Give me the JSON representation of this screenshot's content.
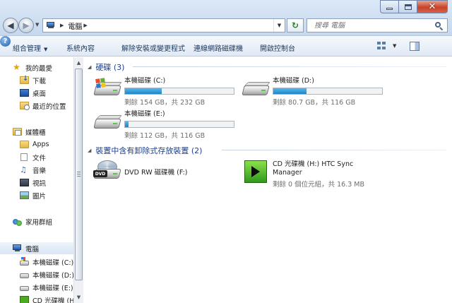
{
  "address": {
    "location": "電腦"
  },
  "search": {
    "placeholder": "搜尋 電腦"
  },
  "toolbar": {
    "organize": "組合管理",
    "system_properties": "系統內容",
    "uninstall": "解除安裝或變更程式",
    "map_network": "連線網路磁碟機",
    "control_panel": "開啟控制台"
  },
  "sidebar": {
    "favorites": "我的最愛",
    "downloads": "下載",
    "desktop": "桌面",
    "recent": "最近的位置",
    "libraries": "媒體櫃",
    "apps": "Apps",
    "documents": "文件",
    "music": "音樂",
    "videos": "視訊",
    "pictures": "圖片",
    "homegroup": "家用群組",
    "computer": "電腦",
    "drive_c": "本機磁碟 (C:)",
    "drive_d": "本機磁碟 (D:)",
    "drive_e": "本機磁碟 (E:)",
    "drive_h": "CD 光碟機 (H:"
  },
  "groups": {
    "hdd_header": "硬碟 (3)",
    "removable_header": "裝置中含有卸除式存放裝置 (2)"
  },
  "drives": {
    "c": {
      "name": "本機磁碟 (C:)",
      "space": "剩餘 154 GB，共 232 GB",
      "used_fraction": 0.336
    },
    "d": {
      "name": "本機磁碟 (D:)",
      "space": "剩餘 80.7 GB，共 116 GB",
      "used_fraction": 0.304
    },
    "e": {
      "name": "本機磁碟 (E:)",
      "space": "剩餘 112 GB，共 116 GB",
      "used_fraction": 0.034
    },
    "f": {
      "name": "DVD RW 磁碟機 (F:)"
    },
    "h": {
      "name_line1": "CD 光碟機 (H:) HTC Sync",
      "name_line2": "Manager",
      "space": "剩餘 0 個位元組，共 16.3 MB"
    }
  },
  "colors": {
    "accent": "#1e3f8a",
    "bar_fill": "#26a0da"
  }
}
